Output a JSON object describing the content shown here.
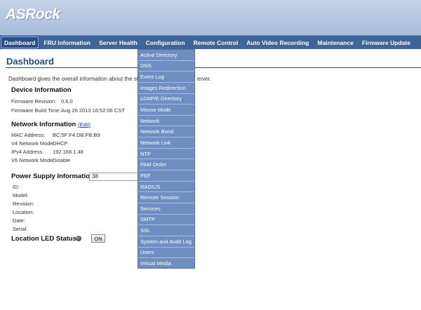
{
  "brand": {
    "logo_text": "ASRock"
  },
  "nav": {
    "items": [
      {
        "label": "Dashboard",
        "active": true
      },
      {
        "label": "FRU Information",
        "active": false
      },
      {
        "label": "Server Health",
        "active": false
      },
      {
        "label": "Configuration",
        "active": false
      },
      {
        "label": "Remote Control",
        "active": false
      },
      {
        "label": "Auto Video Recording",
        "active": false
      },
      {
        "label": "Maintenance",
        "active": false
      },
      {
        "label": "Firmware Update",
        "active": false
      }
    ]
  },
  "page": {
    "title": "Dashboard",
    "description": "Dashboard gives the overall information about the status o",
    "description_tail": "erver."
  },
  "device_info": {
    "heading": "Device Information",
    "firmware_revision_label": "Firmware Revision:",
    "firmware_revision": "0.6.0",
    "firmware_build_time_label": "Firmware Build Time:",
    "firmware_build_time": "Aug 26 2013 16:52:06 CST"
  },
  "network_info": {
    "heading": "Network Information",
    "edit_label": "Edit",
    "mac_label": "MAC Address:",
    "mac": "BC:5F:F4:DB:FB:B9",
    "v4_mode_label": "V4 Network Mode:",
    "v4_mode": "DHCP",
    "ipv4_label": "IPv4 Address:",
    "ipv4": "192.168.1.48",
    "v6_mode_label": "V6 Network Mode:",
    "v6_mode": "Disable"
  },
  "power_supply": {
    "heading": "Power Supply Information:",
    "selected": "38",
    "fields": [
      "ID:",
      "Model:",
      "Revision:",
      "Location:",
      "Date:",
      "Serial:"
    ]
  },
  "location_led": {
    "label": "Location LED Status :",
    "button_label": "ON"
  },
  "config_menu": {
    "items": [
      "Active Directory",
      "DNS",
      "Event Log",
      "Images Redirection",
      "LDAP/E-Directory",
      "Mouse Mode",
      "Network",
      "Network Bond",
      "Network Link",
      "NTP",
      "PAM Order",
      "PEF",
      "RADIUS",
      "Remote Session",
      "Services",
      "SMTP",
      "SSL",
      "System and Audit Log",
      "Users",
      "Virtual Media"
    ]
  }
}
